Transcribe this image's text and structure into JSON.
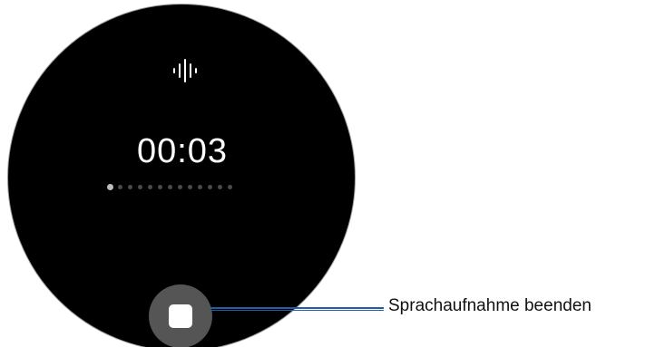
{
  "watch": {
    "icon": "waveform-icon",
    "timer": "00:03",
    "progress": {
      "total_dots": 13,
      "active_index": 0
    },
    "stop_button": {
      "icon": "stop-icon"
    }
  },
  "callout": {
    "label": "Sprachaufnahme beenden",
    "color": "#1f5fa6"
  },
  "colors": {
    "face": "#000000",
    "button": "#555555",
    "text": "#ffffff"
  }
}
